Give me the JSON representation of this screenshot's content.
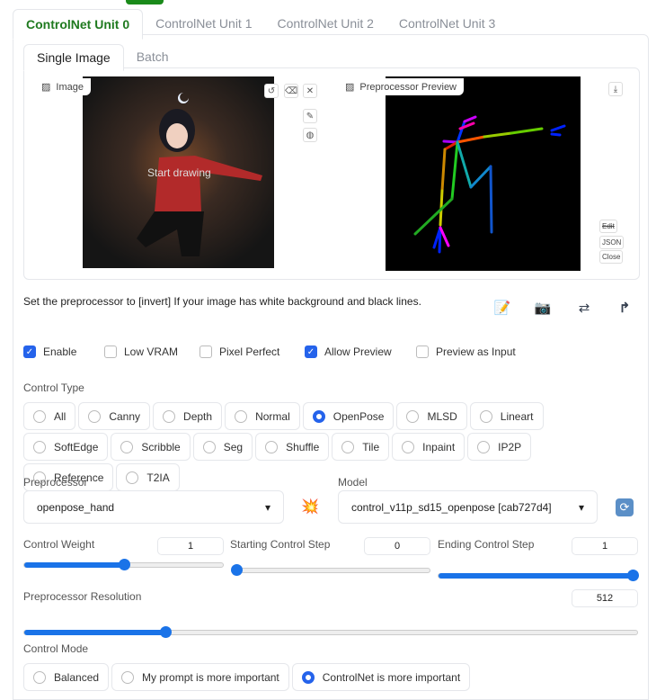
{
  "tabs": [
    "ControlNet Unit 0",
    "ControlNet Unit 1",
    "ControlNet Unit 2",
    "ControlNet Unit 3"
  ],
  "subtabs": [
    "Single Image",
    "Batch"
  ],
  "image": {
    "label": "Image",
    "overlay": "Start drawing"
  },
  "preview": {
    "label": "Preprocessor Preview",
    "buttons": [
      "Edit",
      "JSON",
      "Close"
    ]
  },
  "hint": "Set the preprocessor to [invert] If your image has white background and black lines.",
  "checkboxes": [
    {
      "label": "Enable",
      "checked": true
    },
    {
      "label": "Low VRAM",
      "checked": false
    },
    {
      "label": "Pixel Perfect",
      "checked": false
    },
    {
      "label": "Allow Preview",
      "checked": true
    },
    {
      "label": "Preview as Input",
      "checked": false
    }
  ],
  "control_type": {
    "label": "Control Type",
    "options": [
      "All",
      "Canny",
      "Depth",
      "Normal",
      "OpenPose",
      "MLSD",
      "Lineart",
      "SoftEdge",
      "Scribble",
      "Seg",
      "Shuffle",
      "Tile",
      "Inpaint",
      "IP2P",
      "Reference",
      "T2IA"
    ],
    "selected": "OpenPose"
  },
  "preprocessor": {
    "label": "Preprocessor",
    "value": "openpose_hand"
  },
  "model": {
    "label": "Model",
    "value": "control_v11p_sd15_openpose [cab727d4]"
  },
  "sliders": {
    "weight": {
      "label": "Control Weight",
      "value": "1",
      "fraction": 0.5
    },
    "start": {
      "label": "Starting Control Step",
      "value": "0",
      "fraction": 0
    },
    "end": {
      "label": "Ending Control Step",
      "value": "1",
      "fraction": 1
    },
    "resolution": {
      "label": "Preprocessor Resolution",
      "value": "512",
      "fraction": 0.23
    }
  },
  "control_mode": {
    "label": "Control Mode",
    "options": [
      "Balanced",
      "My prompt is more important",
      "ControlNet is more important"
    ],
    "selected": "ControlNet is more important"
  },
  "accent": "#2563eb"
}
